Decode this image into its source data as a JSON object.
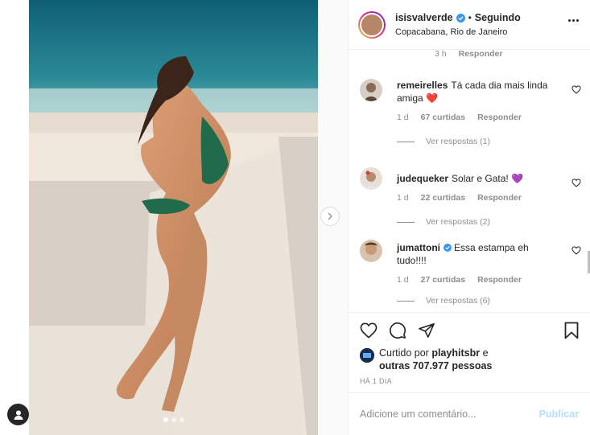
{
  "post": {
    "username": "isisvalverde",
    "separator": "•",
    "following_label": "Seguindo",
    "location": "Copacabana, Rio de Janeiro",
    "carousel_dots": 3
  },
  "top_meta": {
    "time": "3 h",
    "reply": "Responder"
  },
  "comments": [
    {
      "username": "remeirelles",
      "text": "Tá cada dia mais linda amiga",
      "emoji": "❤️",
      "time": "1 d",
      "likes": "67 curtidas",
      "reply": "Responder",
      "view_replies": "Ver respostas (1)"
    },
    {
      "username": "judequeker",
      "text": "Solar e Gata!",
      "emoji": "💜",
      "time": "1 d",
      "likes": "22 curtidas",
      "reply": "Responder",
      "view_replies": "Ver respostas (2)"
    },
    {
      "username": "jumattoni",
      "text": "Essa estampa eh tudo!!!!",
      "emoji": "",
      "time": "1 d",
      "likes": "27 curtidas",
      "reply": "Responder",
      "view_replies": "Ver respostas (6)"
    }
  ],
  "likes": {
    "prefix": "Curtido por",
    "user": "playhitsbr",
    "mid": "e",
    "others": "outras 707.977 pessoas"
  },
  "timestamp": "HÁ 1 DIA",
  "add_comment": {
    "placeholder": "Adicione um comentário...",
    "publish": "Publicar"
  },
  "colors": {
    "verified": "#3897f0",
    "heart_red": "#ed4956",
    "publish_disabled": "#b2dffc"
  }
}
